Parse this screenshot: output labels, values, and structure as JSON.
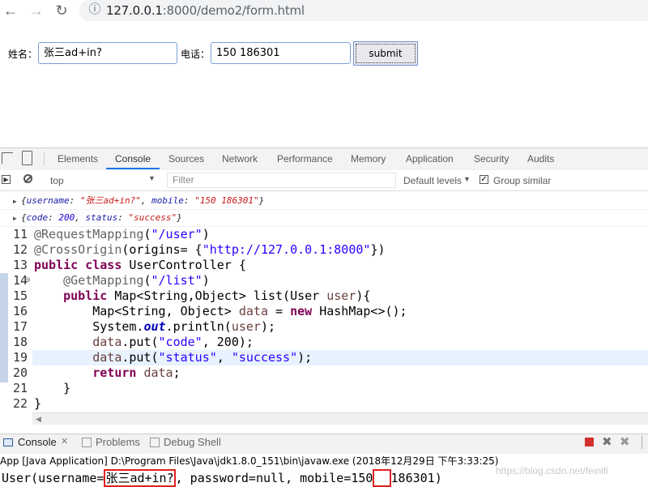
{
  "browser": {
    "url_host": "127.0.0.1",
    "url_rest": ":8000/demo2/form.html"
  },
  "form": {
    "name_label": "姓名：",
    "name_value": "张三ad+in?",
    "phone_label": "电话：",
    "phone_value": "150  186301",
    "submit_label": "submit"
  },
  "devtools": {
    "tabs": [
      "Elements",
      "Console",
      "Sources",
      "Network",
      "Performance",
      "Memory",
      "Application",
      "Security",
      "Audits"
    ],
    "active_tab": "Console",
    "context": "top",
    "filter_placeholder": "Filter",
    "levels": "Default levels",
    "group_similar": "Group similar",
    "log1": {
      "open": "{",
      "k1": "username",
      "v1": "\"张三ad+in?\"",
      "k2": "mobile",
      "v2": "\"150  186301\"",
      "close": "}"
    },
    "log2": {
      "open": "{",
      "k1": "code",
      "v1": "200",
      "k2": "status",
      "v2": "\"success\"",
      "close": "}"
    }
  },
  "editor": {
    "line_numbers": [
      "11",
      "12",
      "13",
      "14",
      "15",
      "16",
      "17",
      "18",
      "19",
      "20",
      "21",
      "22"
    ],
    "l11_ann": "@RequestMapping",
    "l11_str": "\"/user\"",
    "l12_ann": "@CrossOrigin",
    "l12_mid": "(origins= {",
    "l12_str": "\"http://127.0.0.1:8000\"",
    "l12_end": "})",
    "l13_kw1": "public",
    "l13_kw2": "class",
    "l13_rest": " UserController {",
    "l14_ann": "@GetMapping",
    "l14_str": "\"/list\"",
    "l15_kw": "public",
    "l15_a": " Map<String,Object> list(User ",
    "l15_var": "user",
    "l15_b": "){",
    "l16_a": "Map<String, Object> ",
    "l16_var": "data",
    "l16_b": " = ",
    "l16_kw": "new",
    "l16_c": " HashMap<>();",
    "l17_a": "System.",
    "l17_fld": "out",
    "l17_b": ".println(",
    "l17_var": "user",
    "l17_c": ");",
    "l18_var": "data",
    "l18_a": ".put(",
    "l18_str": "\"code\"",
    "l18_b": ", 200);",
    "l19_var": "data",
    "l19_a": ".put(",
    "l19_str1": "\"status\"",
    "l19_b": ", ",
    "l19_str2": "\"success\"",
    "l19_c": ");",
    "l20_kw": "return",
    "l20_var": "data",
    "l20_end": ";",
    "l21": "}",
    "l22": "}"
  },
  "console_view": {
    "tab_console": "Console",
    "tab_problems": "Problems",
    "tab_debug": "Debug Shell",
    "app_line": "App [Java Application] D:\\Program Files\\Java\\jdk1.8.0_151\\bin\\javaw.exe (2018年12月29日 下午3:33:25)",
    "out_a": "User(username=",
    "out_boxed_name": "张三ad+in?",
    "out_b": ", password=null, mobile=150",
    "out_boxed_gap": "  ",
    "out_c": "186301)"
  },
  "watermark": "https://blog.csdn.net/feinifi"
}
